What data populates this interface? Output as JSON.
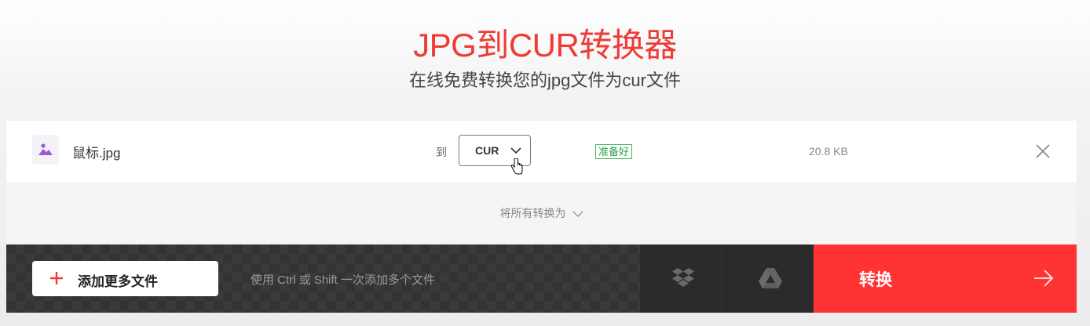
{
  "header": {
    "title": "JPG到CUR转换器",
    "subtitle": "在线免费转换您的jpg文件为cur文件"
  },
  "file": {
    "icon": "image-file-icon",
    "name": "鼠标.jpg",
    "to_label": "到",
    "format_value": "CUR",
    "status": "准备好",
    "size": "20.8 KB",
    "remove_icon": "close-icon"
  },
  "convert_all": {
    "label": "将所有转换为"
  },
  "toolbar": {
    "add_more_label": "添加更多文件",
    "hint": "使用 Ctrl 或 Shift 一次添加多个文件",
    "dropbox_icon": "dropbox-icon",
    "gdrive_icon": "google-drive-icon",
    "convert_label": "转换"
  },
  "colors": {
    "accent": "#ef3b36",
    "convert_button": "#ff3333",
    "status_green": "#3fb65a",
    "bar_dark": "#333333"
  }
}
